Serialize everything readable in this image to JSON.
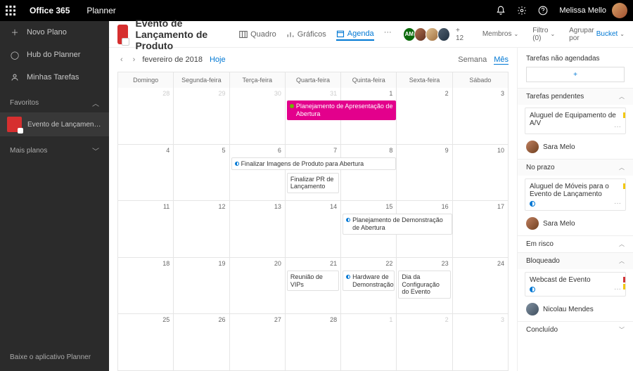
{
  "topbar": {
    "suite": "Office 365",
    "app": "Planner",
    "user": "Melissa Mello"
  },
  "nav": {
    "new_plan": "Novo Plano",
    "hub": "Hub do Planner",
    "my_tasks": "Minhas Tarefas",
    "favorites": "Favoritos",
    "plan_tile": "Evento de Lançamento...",
    "more_plans": "Mais planos",
    "footer": "Baixe o aplicativo Planner"
  },
  "plan": {
    "title": "Evento de Lançamento de Produto",
    "pivots": {
      "board": "Quadro",
      "charts": "Gráficos",
      "schedule": "Agenda"
    },
    "more": "···",
    "members_badge": "AM",
    "members_more": "+ 12",
    "members_label": "Membros",
    "filter_label": "Filtro (0)",
    "groupby_label": "Agrupar por",
    "groupby_value": "Bucket"
  },
  "cal": {
    "prev": "‹",
    "next": "›",
    "month": "fevereiro de 2018",
    "today": "Hoje",
    "view_week": "Semana",
    "view_month": "Mês",
    "dayheaders": [
      "Domingo",
      "Segunda-feira",
      "Terça-feira",
      "Quarta-feira",
      "Quinta-feira",
      "Sexta-feira",
      "Sábado"
    ],
    "weeks": [
      {
        "days": [
          {
            "n": "28",
            "dim": true
          },
          {
            "n": "29",
            "dim": true
          },
          {
            "n": "30",
            "dim": true
          },
          {
            "n": "31",
            "dim": true,
            "tasks": [
              {
                "text": "Planejamento de Apresentação de Abertura",
                "pink": true,
                "span": 2,
                "dot": "bullet"
              }
            ]
          },
          {
            "n": "1"
          },
          {
            "n": "2"
          },
          {
            "n": "3"
          }
        ]
      },
      {
        "days": [
          {
            "n": "4"
          },
          {
            "n": "5"
          },
          {
            "n": "6",
            "tasks": [
              {
                "text": "Finalizar Imagens de Produto para Abertura",
                "span": 3,
                "dot": "half"
              }
            ]
          },
          {
            "n": "7",
            "tasks": [
              {
                "text": "Finalizar PR de Lançamento",
                "second": true
              }
            ]
          },
          {
            "n": "8"
          },
          {
            "n": "9"
          },
          {
            "n": "10"
          }
        ]
      },
      {
        "days": [
          {
            "n": "11"
          },
          {
            "n": "12"
          },
          {
            "n": "13"
          },
          {
            "n": "14"
          },
          {
            "n": "15",
            "tasks": [
              {
                "text": "Planejamento de Demonstração de Abertura",
                "span": 2,
                "dot": "half"
              }
            ]
          },
          {
            "n": "16"
          },
          {
            "n": "17"
          }
        ]
      },
      {
        "days": [
          {
            "n": "18"
          },
          {
            "n": "19"
          },
          {
            "n": "20"
          },
          {
            "n": "21",
            "tasks": [
              {
                "text": "Reunião de VIPs"
              }
            ]
          },
          {
            "n": "22",
            "tasks": [
              {
                "text": "Hardware de Demonstração",
                "dot": "half"
              }
            ]
          },
          {
            "n": "23",
            "tasks": [
              {
                "text": "Dia da Configuração do Evento"
              }
            ]
          },
          {
            "n": "24"
          }
        ]
      },
      {
        "days": [
          {
            "n": "25"
          },
          {
            "n": "26"
          },
          {
            "n": "27"
          },
          {
            "n": "28"
          },
          {
            "n": "1",
            "dim": true
          },
          {
            "n": "2",
            "dim": true
          },
          {
            "n": "3",
            "dim": true
          }
        ]
      }
    ]
  },
  "panel": {
    "unscheduled": "Tarefas não agendadas",
    "add": "+",
    "pending": {
      "label": "Tarefas pendentes",
      "card_title": "Aluguel de Equipamento de A/V",
      "assignee": "Sara Melo",
      "stripe_color": "#f2c811"
    },
    "ontime": {
      "label": "No prazo",
      "card_title": "Aluguel de Móveis para o Evento de Lançamento",
      "assignee": "Sara Melo",
      "stripe_color": "#f2c811"
    },
    "atrisk": "Em risco",
    "blocked": {
      "label": "Bloqueado",
      "card_title": "Webcast de Evento",
      "assignee": "Nicolau Mendes",
      "stripe1": "#d13438",
      "stripe2": "#f2c811"
    },
    "done": "Concluído"
  }
}
